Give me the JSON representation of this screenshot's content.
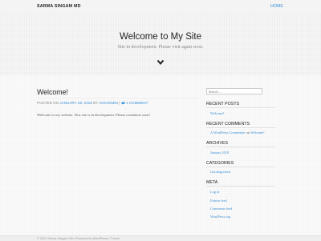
{
  "navbar": {
    "brand": "SARMA SINGAM MD",
    "home_label": "HOME"
  },
  "hero": {
    "title": "Welcome to My Site",
    "description": "Site in development. Please visit again soon.",
    "scroll_icon": "chevron-down-icon"
  },
  "post": {
    "title": "Welcome!",
    "meta": {
      "posted_on": "POSTED ON",
      "date": "JANUARY 28, 2018",
      "by": "BY",
      "author": "AVSADMIN",
      "separator": "|",
      "comment_icon": "comment-icon",
      "comments": "1 COMMENT"
    },
    "body": "Welcome to my website. This site is in development. Please comeback soon!"
  },
  "sidebar": {
    "search_placeholder": "Search …",
    "recent_posts": {
      "title": "RECENT POSTS",
      "items": [
        "Welcome!"
      ]
    },
    "recent_comments": {
      "title": "RECENT COMMENTS",
      "items": [
        {
          "author": "A WordPress Commenter",
          "on": "on",
          "post": "Welcome!"
        }
      ]
    },
    "archives": {
      "title": "ARCHIVES",
      "items": [
        "January 2018"
      ]
    },
    "categories": {
      "title": "CATEGORIES",
      "items": [
        "Uncategorized"
      ]
    },
    "meta": {
      "title": "META",
      "items": [
        "Log in",
        "Entries feed",
        "Comments feed",
        "WordPress.org"
      ]
    }
  },
  "footer": {
    "text": "© 2024 Sarma Singam MD | Powered by WordPress | Theme"
  },
  "colors": {
    "link": "#3b8fd6",
    "heading": "#222222",
    "muted": "#888888"
  }
}
